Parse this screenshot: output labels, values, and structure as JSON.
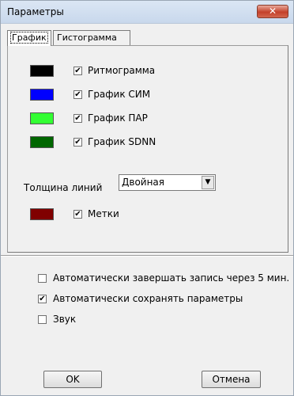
{
  "window": {
    "title": "Параметры",
    "close_icon": "close-icon",
    "close_glyph": "✕"
  },
  "tabs": [
    {
      "label": "График",
      "active": true
    },
    {
      "label": "Гистограмма",
      "active": false
    }
  ],
  "series": [
    {
      "label": "Ритмограмма",
      "checked": true,
      "color": "#000000"
    },
    {
      "label": "График СИМ",
      "checked": true,
      "color": "#0000ff"
    },
    {
      "label": "График ПАР",
      "checked": true,
      "color": "#33ff33"
    },
    {
      "label": "График SDNN",
      "checked": true,
      "color": "#006600"
    }
  ],
  "line_width": {
    "label": "Толщина линий",
    "value": "Двойная"
  },
  "marks": {
    "label": "Метки",
    "checked": true,
    "color": "#800000"
  },
  "options": [
    {
      "label": "Автоматически завершать запись через 5 мин.",
      "checked": false
    },
    {
      "label": "Автоматически сохранять параметры",
      "checked": true
    },
    {
      "label": "Звук",
      "checked": false
    }
  ],
  "buttons": {
    "ok": "OK",
    "cancel": "Отмена"
  },
  "check_glyph": "✔",
  "dropdown_glyph": "▼"
}
